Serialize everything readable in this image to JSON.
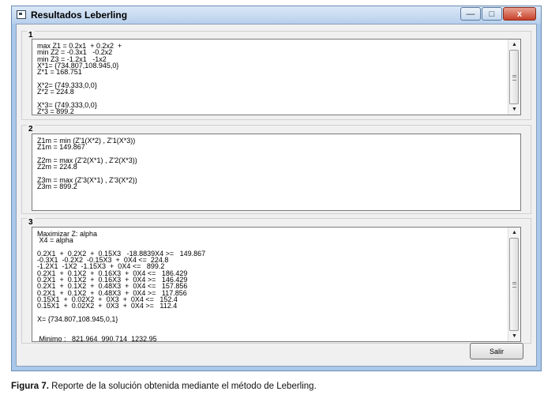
{
  "window": {
    "title": "Resultados Leberling",
    "controls": {
      "minimize": "—",
      "maximize": "□",
      "close": "x"
    }
  },
  "groups": [
    {
      "label": "1",
      "text": "max Z1 = 0.2x1  + 0.2x2  +\nmin Z2 = -0.3x1   -0.2x2\nmin Z3 = -1.2x1   -1x2\nX*1= {734.807,108.945,0}\nZ*1 = 168.751\n\nX*2= {749.333,0,0}\nZ*2 = 224.8\n\nX*3= {749.333,0,0}\nZ*3 = 899.2"
    },
    {
      "label": "2",
      "text": "Z1m = min (Z'1(X*2) , Z'1(X*3))\nZ1m = 149.867\n\nZ2m = max (Z'2(X*1) , Z'2(X*3))\nZ2m = 224.8\n\nZ3m = max (Z'3(X*1) , Z'3(X*2))\nZ3m = 899.2"
    },
    {
      "label": "3",
      "text": "Maximizar Z: alpha\n X4 = alpha\n\n0.2X1  +  0.2X2  +  0.15X3   -18.8839X4 >=   149.867\n-0.3X1  -0.2X2  -0.15X3  +  0X4 <=  224.8\n-1.2X1  -1X2  -1.15X3  +  0X4 <=   899.2\n0.2X1  +  0.1X2  +  0.16X3  +  0X4 <=   186.429\n0.2X1  +  0.1X2  +  0.16X3  +  0X4 >=   146.429\n0.2X1  +  0.1X2  +  0.48X3  +  0X4 <=   157.856\n0.2X1  +  0.1X2  +  0.48X3  +  0X4 >=   117.856\n0.15X1  +  0.02X2  +  0X3  +  0X4 <=   152.4\n0.15X1  +  0.02X2  +  0X3  +  0X4 >=   112.4\n\nX= {734.807,108.945,0,1}\n\n\n Minimo :   821.964  990.714  1232.95"
    }
  ],
  "buttons": {
    "exit_label": "Salir"
  },
  "caption": {
    "figure": "Figura 7.",
    "text": " Reporte de la solución obtenida mediante el método de Leberling."
  }
}
